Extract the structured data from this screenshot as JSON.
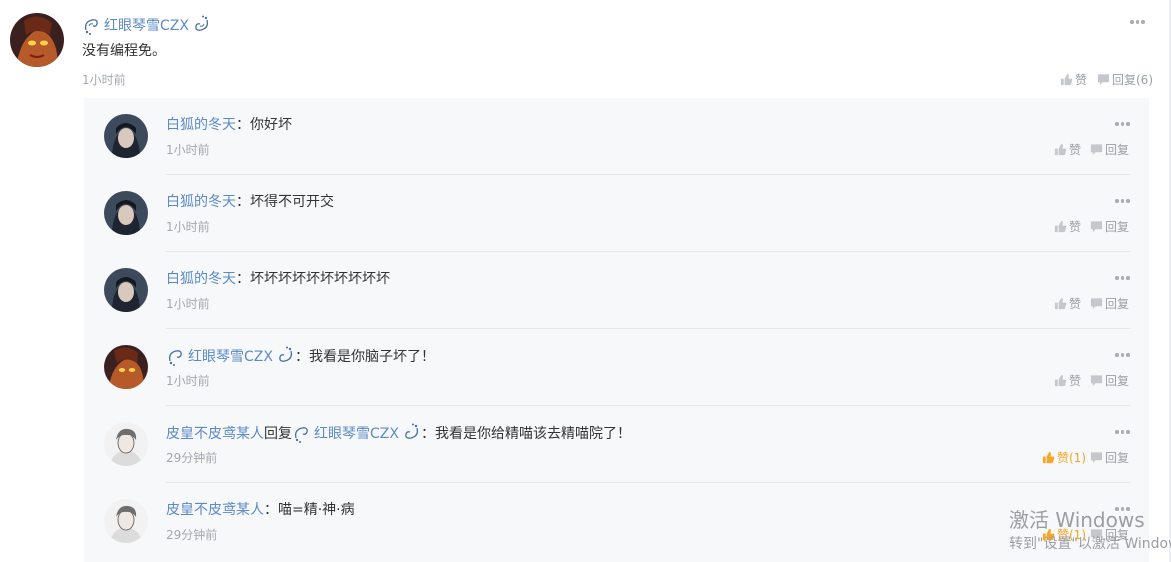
{
  "top_comment": {
    "author": "红眼琴雪CZX",
    "content": "没有编程免。",
    "time": "1小时前",
    "like_label": "赞",
    "reply_label": "回复(6)"
  },
  "replies": [
    {
      "author": "白狐的冬天",
      "sep": "：",
      "content": "你好坏",
      "time": "1小时前",
      "like_label": "赞",
      "reply_label": "回复"
    },
    {
      "author": "白狐的冬天",
      "sep": "：",
      "content": "坏得不可开交",
      "time": "1小时前",
      "like_label": "赞",
      "reply_label": "回复"
    },
    {
      "author": "白狐的冬天",
      "sep": "：",
      "content": "坏坏坏坏坏坏坏坏坏坏",
      "time": "1小时前",
      "like_label": "赞",
      "reply_label": "回复"
    },
    {
      "author": "红眼琴雪CZX",
      "sep": "：",
      "content": "我看是你脑子坏了！",
      "time": "1小时前",
      "like_label": "赞",
      "reply_label": "回复"
    },
    {
      "author": "皮皇不皮鸢某人",
      "reply_word": "回复",
      "target": "红眼琴雪CZX",
      "sep": "：",
      "content": "我看是你给精喵该去精喵院了！",
      "time": "29分钟前",
      "like_label": "赞(1)",
      "reply_label": "回复"
    },
    {
      "author": "皮皇不皮鸢某人",
      "sep": "：",
      "content": "喵=精·神·病",
      "time": "29分钟前",
      "like_label": "赞(1)",
      "reply_label": "回复"
    }
  ],
  "watermark": {
    "line1": "激活 Windows",
    "line2": "转到\"设置\"以激活 Windows。"
  },
  "colors": {
    "name": "#5b8ac6",
    "liked": "#f5a623",
    "reply_bg": "#f7f8fa"
  },
  "icons": [
    "more-icon",
    "thumbs-up-icon",
    "comment-icon",
    "swirl-decoration-icon"
  ]
}
